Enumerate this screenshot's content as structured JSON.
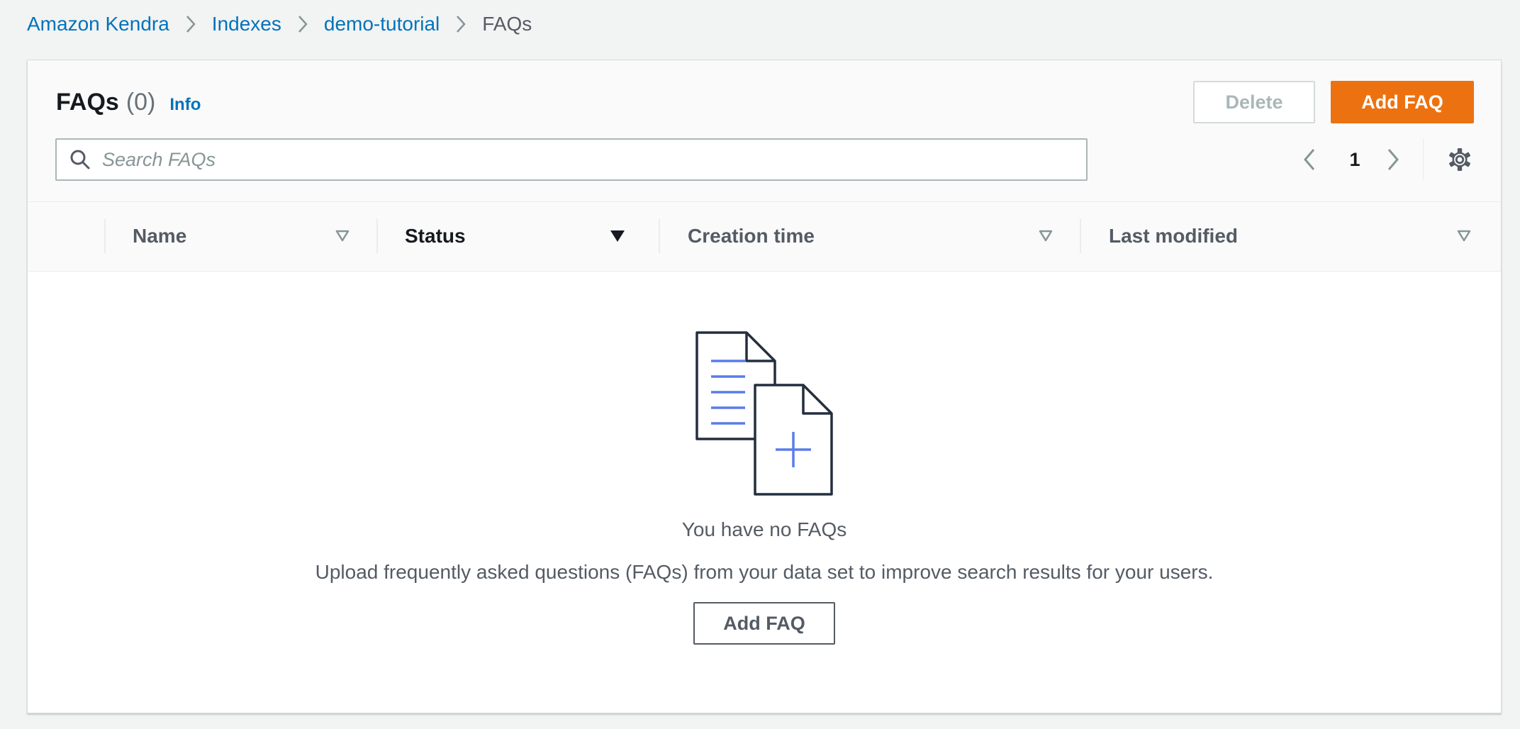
{
  "breadcrumb": {
    "items": [
      "Amazon Kendra",
      "Indexes",
      "demo-tutorial"
    ],
    "current": "FAQs"
  },
  "header": {
    "title": "FAQs",
    "count": "(0)",
    "info_label": "Info",
    "delete_label": "Delete",
    "add_label": "Add FAQ"
  },
  "search": {
    "placeholder": "Search FAQs",
    "value": ""
  },
  "pagination": {
    "current_page": "1"
  },
  "table": {
    "columns": [
      "Name",
      "Status",
      "Creation time",
      "Last modified"
    ],
    "sorted_column": "Status"
  },
  "empty_state": {
    "title": "You have no FAQs",
    "description": "Upload frequently asked questions (FAQs) from your data set to improve search results for your users.",
    "button_label": "Add FAQ"
  },
  "colors": {
    "accent": "#ec7211",
    "link": "#0073bb",
    "illustration_lines": "#5a7de8"
  },
  "icons": {
    "breadcrumb_separator": "chevron-right-icon",
    "search": "search-icon",
    "prev_page": "chevron-left-icon",
    "next_page": "chevron-right-icon",
    "settings": "gear-icon",
    "sort": "caret-down-icon",
    "empty": "documents-add-illustration"
  }
}
